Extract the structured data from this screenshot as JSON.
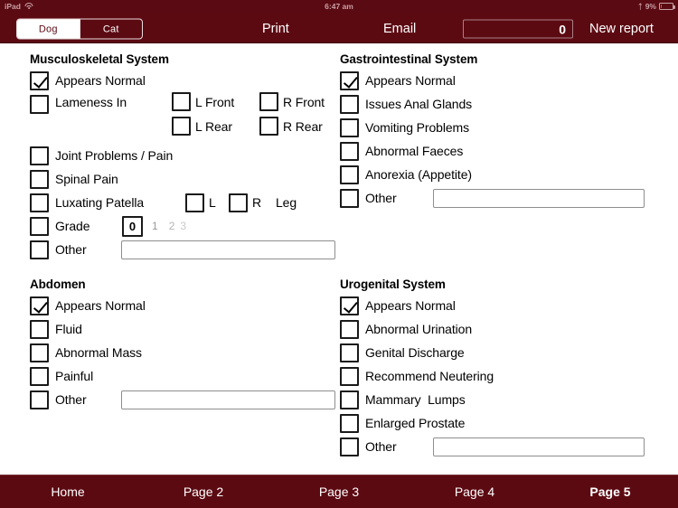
{
  "statusbar": {
    "device": "iPad",
    "wifi_icon": "wifi-icon",
    "time": "6:47 am",
    "bluetooth_icon": "bluetooth-icon",
    "battery_percent": "9%",
    "battery_icon": "battery-icon"
  },
  "navbar": {
    "segments": [
      {
        "label": "Dog",
        "active": true
      },
      {
        "label": "Cat",
        "active": false
      }
    ],
    "print_label": "Print",
    "email_label": "Email",
    "count_value": "0",
    "new_report_label": "New report"
  },
  "sections": {
    "musculoskeletal": {
      "title": "Musculoskeletal System",
      "items": [
        {
          "label": "Appears Normal",
          "checked": true
        },
        {
          "label": "Lameness In",
          "checked": false
        },
        {
          "label": "Joint Problems / Pain",
          "checked": false
        },
        {
          "label": "Spinal Pain",
          "checked": false
        },
        {
          "label": "Luxating Patella",
          "checked": false
        },
        {
          "label": "Grade",
          "checked": false
        },
        {
          "label": "Other",
          "checked": false
        }
      ],
      "lameness_options": [
        {
          "label": "L Front",
          "checked": false
        },
        {
          "label": "R Front",
          "checked": false
        },
        {
          "label": "L Rear",
          "checked": false
        },
        {
          "label": "R Rear",
          "checked": false
        }
      ],
      "patella_options": [
        {
          "label": "L",
          "checked": false
        },
        {
          "label": "R",
          "checked": false
        }
      ],
      "patella_suffix": "Leg",
      "grade_selected": "0",
      "grade_options": [
        "1",
        "2",
        "3"
      ],
      "other_value": "",
      "other_placeholder": ""
    },
    "gastrointestinal": {
      "title": "Gastrointestinal System",
      "items": [
        {
          "label": "Appears Normal",
          "checked": true
        },
        {
          "label": "Issues Anal Glands",
          "checked": false
        },
        {
          "label": "Vomiting Problems",
          "checked": false
        },
        {
          "label": "Abnormal Faeces",
          "checked": false
        },
        {
          "label": "Anorexia (Appetite)",
          "checked": false
        },
        {
          "label": "Other",
          "checked": false
        }
      ],
      "other_value": "",
      "other_placeholder": ""
    },
    "abdomen": {
      "title": "Abdomen",
      "items": [
        {
          "label": "Appears Normal",
          "checked": true
        },
        {
          "label": "Fluid",
          "checked": false
        },
        {
          "label": "Abnormal Mass",
          "checked": false
        },
        {
          "label": "Painful",
          "checked": false
        },
        {
          "label": "Other",
          "checked": false
        }
      ],
      "other_value": "",
      "other_placeholder": ""
    },
    "urogenital": {
      "title": "Urogenital System",
      "items": [
        {
          "label": "Appears Normal",
          "checked": true
        },
        {
          "label": "Abnormal Urination",
          "checked": false
        },
        {
          "label": "Genital Discharge",
          "checked": false
        },
        {
          "label": "Recommend Neutering",
          "checked": false
        },
        {
          "label": "Mammary  Lumps",
          "checked": false
        },
        {
          "label": "Enlarged Prostate",
          "checked": false
        },
        {
          "label": "Other",
          "checked": false
        }
      ],
      "other_value": "",
      "other_placeholder": ""
    }
  },
  "tabbar": {
    "tabs": [
      {
        "label": "Home",
        "active": false
      },
      {
        "label": "Page 2",
        "active": false
      },
      {
        "label": "Page 3",
        "active": false
      },
      {
        "label": "Page 4",
        "active": false
      },
      {
        "label": "Page 5",
        "active": true
      }
    ]
  },
  "colors": {
    "brand": "#5c0a12",
    "status_bar": "#5a0a12",
    "field_border": "#8e8e8e",
    "checkbox_border": "#1a1a1a",
    "battery_low": "#e24a4a"
  }
}
